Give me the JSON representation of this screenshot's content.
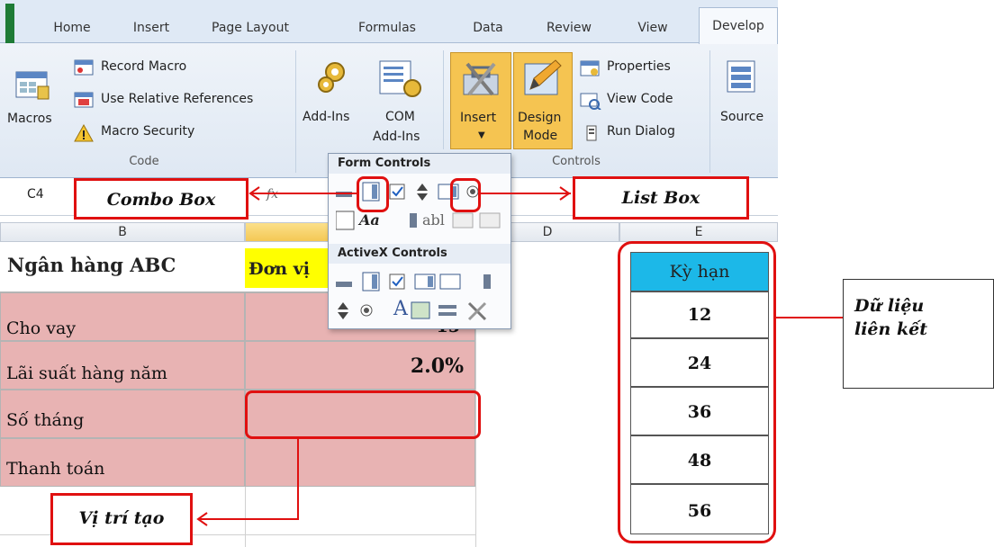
{
  "ribbon": {
    "tabs": [
      "Home",
      "Insert",
      "Page Layout",
      "Formulas",
      "Data",
      "Review",
      "View",
      "Develop"
    ],
    "active_tab": "Develop",
    "code_group": {
      "macros_label": "Macros",
      "record_macro": "Record Macro",
      "relative_refs": "Use Relative References",
      "macro_security": "Macro Security",
      "label": "Code"
    },
    "addins_group": {
      "addins_label": "Add-Ins",
      "com_label_1": "COM",
      "com_label_2": "Add-Ins"
    },
    "controls_group": {
      "insert_label": "Insert",
      "design_label_1": "Design",
      "design_label_2": "Mode",
      "properties": "Properties",
      "view_code": "View Code",
      "run_dialog": "Run Dialog",
      "label": "Controls"
    },
    "source_label": "Source"
  },
  "formula_bar": {
    "name_box": "C4",
    "fx": "fx"
  },
  "controls_menu": {
    "form_controls": "Form Controls",
    "activex_controls": "ActiveX Controls",
    "aa_text": "Aa",
    "abl_text": "abl",
    "a_text": "A"
  },
  "sheet": {
    "col_headers": [
      "B",
      "D",
      "E"
    ],
    "bank_title": "Ngân hàng ABC",
    "unit_header": "Đơn vị",
    "rows": [
      {
        "label": "Cho vay",
        "value": "15"
      },
      {
        "label": "Lãi suất hàng năm",
        "value": "2.0%"
      },
      {
        "label": "Số tháng",
        "value": ""
      },
      {
        "label": "Thanh toán",
        "value": ""
      }
    ],
    "term_header": "Kỳ hạn",
    "terms": [
      "12",
      "24",
      "36",
      "48",
      "56"
    ]
  },
  "annotations": {
    "combo_box": "Combo Box",
    "list_box": "List Box",
    "linked_data_1": "Dữ liệu",
    "linked_data_2": "liên kết",
    "create_position": "Vị trí tạo"
  },
  "colors": {
    "highlight_red": "#e01010",
    "pink_cell": "#e8b3b3",
    "header_cyan": "#1cb8e8",
    "unit_yellow": "#ffff00",
    "active_ribbon": "#f5c451"
  }
}
